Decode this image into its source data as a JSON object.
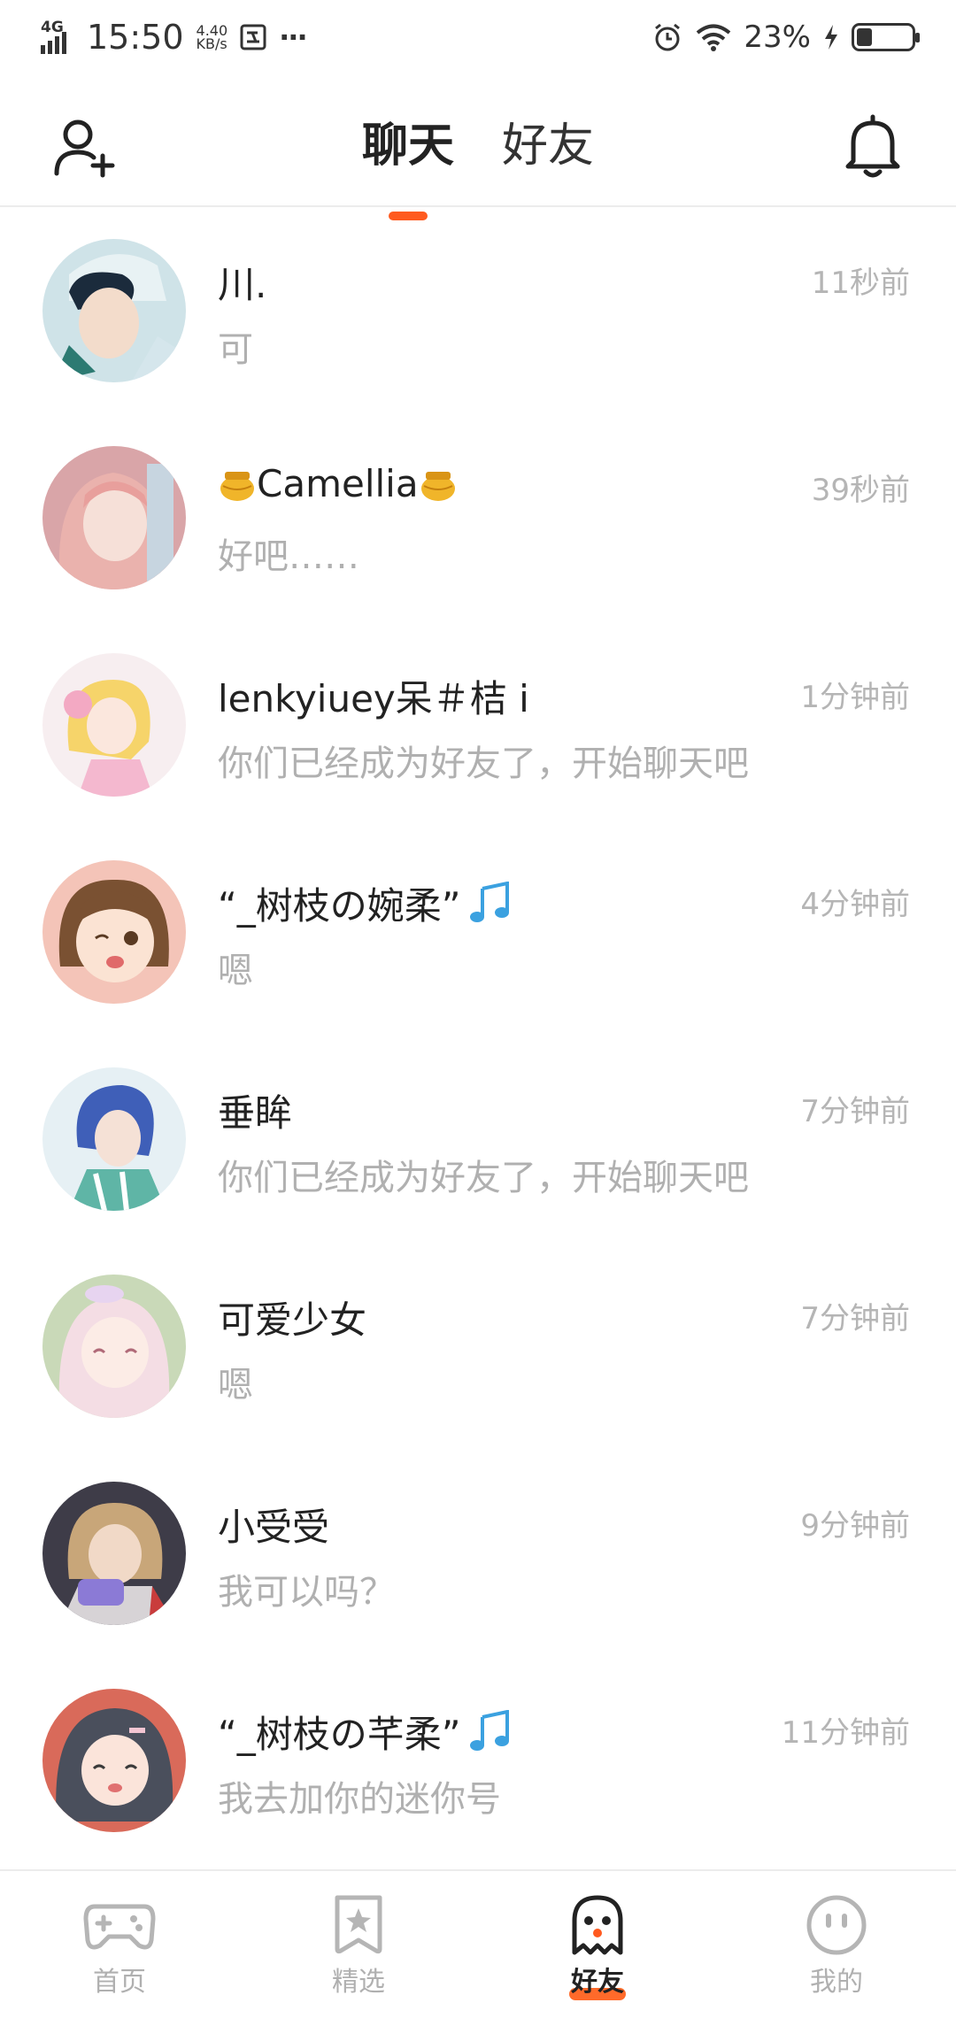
{
  "status_bar": {
    "network": "4G",
    "time": "15:50",
    "speed_value": "4.40",
    "speed_unit": "KB/s",
    "more": "···",
    "battery_percent": "23%",
    "battery_level": 0.23
  },
  "header": {
    "tabs": [
      {
        "label": "聊天",
        "active": true
      },
      {
        "label": "好友",
        "active": false
      }
    ],
    "icons": [
      "add-friend-icon",
      "bell-icon"
    ]
  },
  "chats": [
    {
      "name": "川.",
      "preview": "可",
      "time": "11秒前"
    },
    {
      "name": "Camellia",
      "preview": "好吧……",
      "time": "39秒前"
    },
    {
      "name": "lenkyiuey呆＃桔 i",
      "preview": "你们已经成为好友了，开始聊天吧",
      "time": "1分钟前"
    },
    {
      "name": "“_树枝の婉柔”",
      "preview": "嗯",
      "time": "4分钟前"
    },
    {
      "name": "垂眸",
      "preview": "你们已经成为好友了，开始聊天吧",
      "time": "7分钟前"
    },
    {
      "name": "可爱少女",
      "preview": "嗯",
      "time": "7分钟前"
    },
    {
      "name": "小受受",
      "preview": "我可以吗？",
      "time": "9分钟前"
    },
    {
      "name": "“_树枝の芊柔”",
      "preview": "我去加你的迷你号",
      "time": "11分钟前"
    }
  ],
  "bottom_nav": [
    {
      "label": "首页",
      "icon": "gamepad-icon",
      "active": false
    },
    {
      "label": "精选",
      "icon": "star-bookmark-icon",
      "active": false
    },
    {
      "label": "好友",
      "icon": "ghost-icon",
      "active": true
    },
    {
      "label": "我的",
      "icon": "smiley-icon",
      "active": false
    }
  ],
  "colors": {
    "accent": "#ff5a1f",
    "text_primary": "#222222",
    "text_secondary": "#b0b0b0"
  }
}
